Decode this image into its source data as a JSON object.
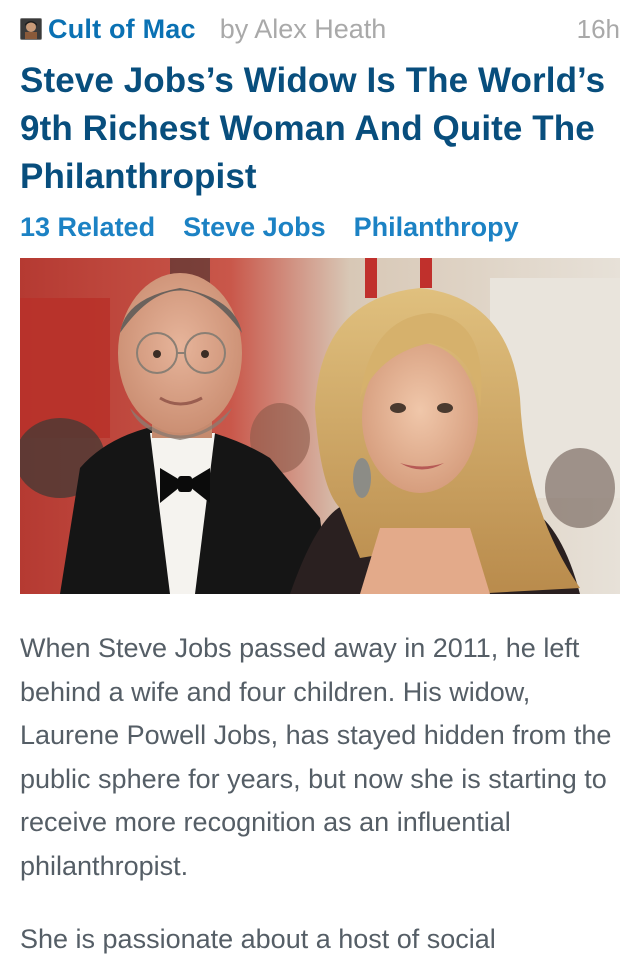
{
  "article": {
    "source": {
      "name": "Cult of Mac",
      "icon": "cult-of-mac-logo-icon"
    },
    "byline": "by Alex Heath",
    "time": "16h",
    "headline": "Steve Jobs’s Widow Is The World’s 9th Richest Woman And Quite The Philanthropist",
    "tags": [
      {
        "label": "13 Related"
      },
      {
        "label": "Steve Jobs"
      },
      {
        "label": "Philanthropy"
      }
    ],
    "image": {
      "subject": "photo of Steve Jobs and Laurene Powell Jobs"
    },
    "paragraphs": [
      "When Steve Jobs passed away in 2011, he left behind a wife and four children. His widow, Laurene Powell Jobs, has stayed hidden from the public sphere for years, but now she is starting to receive more recognition as an influential philanthropist.",
      "She is passionate about a host of social"
    ]
  },
  "colors": {
    "source_link": "#0a71b3",
    "headline": "#084e7d",
    "tag_link": "#1c82c4",
    "meta_gray": "#a9a9a9",
    "body_text": "#555e66"
  }
}
